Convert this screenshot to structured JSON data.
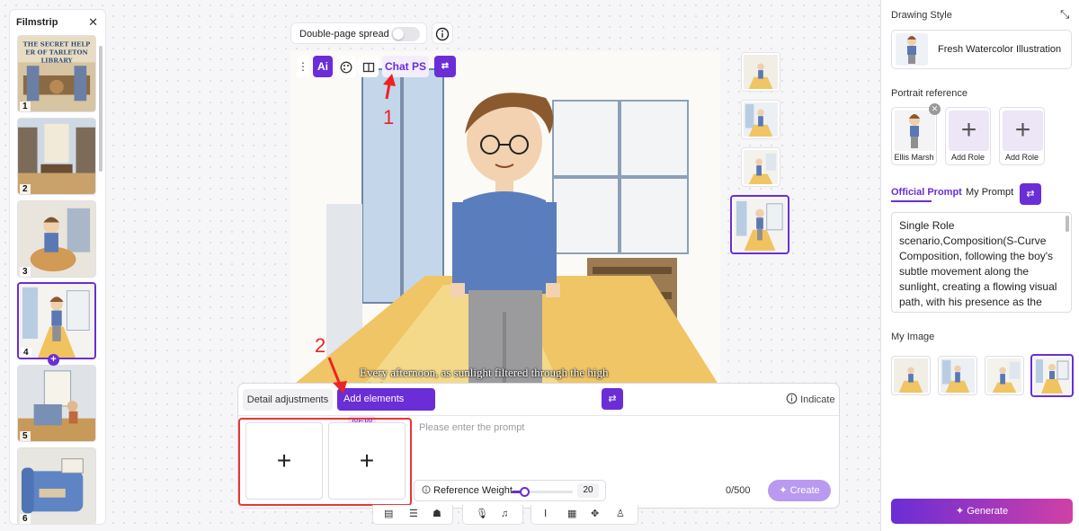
{
  "filmstrip": {
    "title": "Filmstrip",
    "close_icon": "close-icon",
    "pages": [
      {
        "num": "1",
        "cover_text": "THE SECRET HELPER OF TARLETON LIBRARY"
      },
      {
        "num": "2"
      },
      {
        "num": "3"
      },
      {
        "num": "4",
        "selected": true
      },
      {
        "num": "5"
      },
      {
        "num": "6"
      }
    ]
  },
  "toolbar": {
    "spread_label": "Double-page spread",
    "spread_on": false,
    "info_icon": "info-icon"
  },
  "image_toolbar": {
    "more_icon": "more-vertical-icon",
    "ai_label": "Ai",
    "palette_icon": "palette-icon",
    "book_icon": "book-icon",
    "chat_label": "Chat PS",
    "translate_icon": "translate-icon"
  },
  "canvas": {
    "caption": "Every afternoon, as sunlight filtered through the high windows an"
  },
  "annotations": {
    "one": "1",
    "two": "2"
  },
  "bottom_panel": {
    "tab_detail": "Detail adjustments",
    "tab_add": "Add elements",
    "tab_add_badge": "NEW",
    "indicate_label": "Indicate",
    "slot_plus": "+",
    "prompt_placeholder": "Please enter the prompt",
    "ref_weight_label": "Reference Weight",
    "ref_weight_value": "20",
    "ref_weight_fraction": 0.2,
    "counter": "0/500",
    "create_label": "Create"
  },
  "right_panel": {
    "drawing_style_label": "Drawing Style",
    "collapse_icon": "collapse-icon",
    "style_name": "Fresh Watercolor Illustration",
    "portrait_label": "Portrait reference",
    "roles": [
      {
        "caption": "Ellis Marsh",
        "has_photo": true
      },
      {
        "caption": "Add Role",
        "plus": "+"
      },
      {
        "caption": "Add Role",
        "plus": "+"
      }
    ],
    "tab_official": "Official Prompt",
    "tab_my": "My Prompt",
    "prompt_text": "Single Role scenario,Composition(S-Curve Composition, following the boy's subtle movement along the sunlight, creating a flowing visual path, with his presence as the focal point)",
    "my_image_label": "My Image",
    "generate_label": "Generate"
  },
  "colors": {
    "accent": "#6a2dd6",
    "annotation_red": "#e22222"
  }
}
